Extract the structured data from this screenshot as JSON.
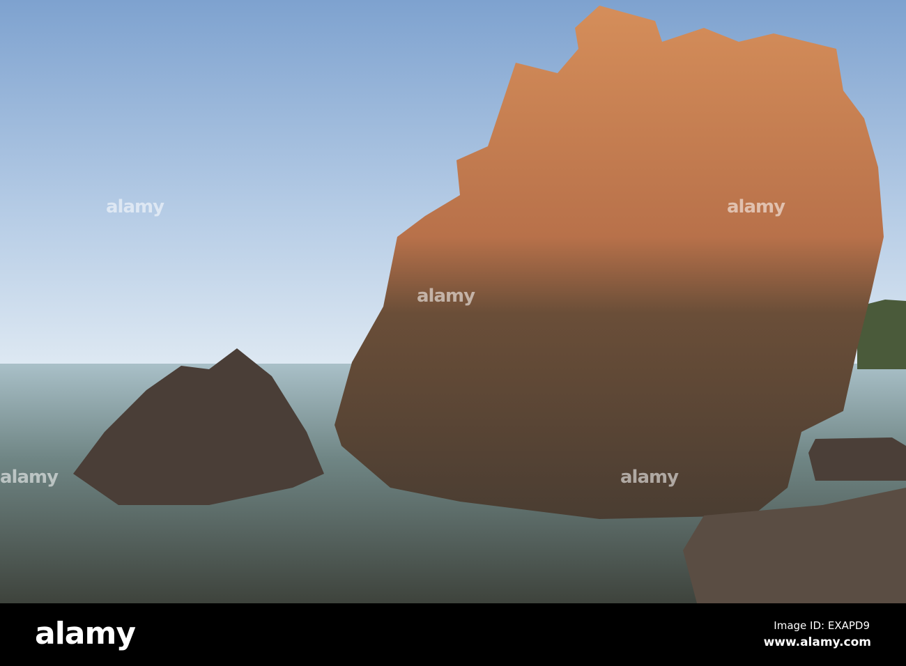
{
  "photo": {
    "subject": "sandstone rocks in calm sea"
  },
  "watermark": {
    "text": "alamy"
  },
  "footer": {
    "logo": "alamy",
    "image_id": "Image ID: EXAPD9",
    "url": "www.alamy.com"
  },
  "colors": {
    "sky_top": "#7fa3cf",
    "sky_bottom": "#dbe7f2",
    "water": "#5b6a69",
    "rock": "#c77f4e",
    "bar": "#000000"
  }
}
